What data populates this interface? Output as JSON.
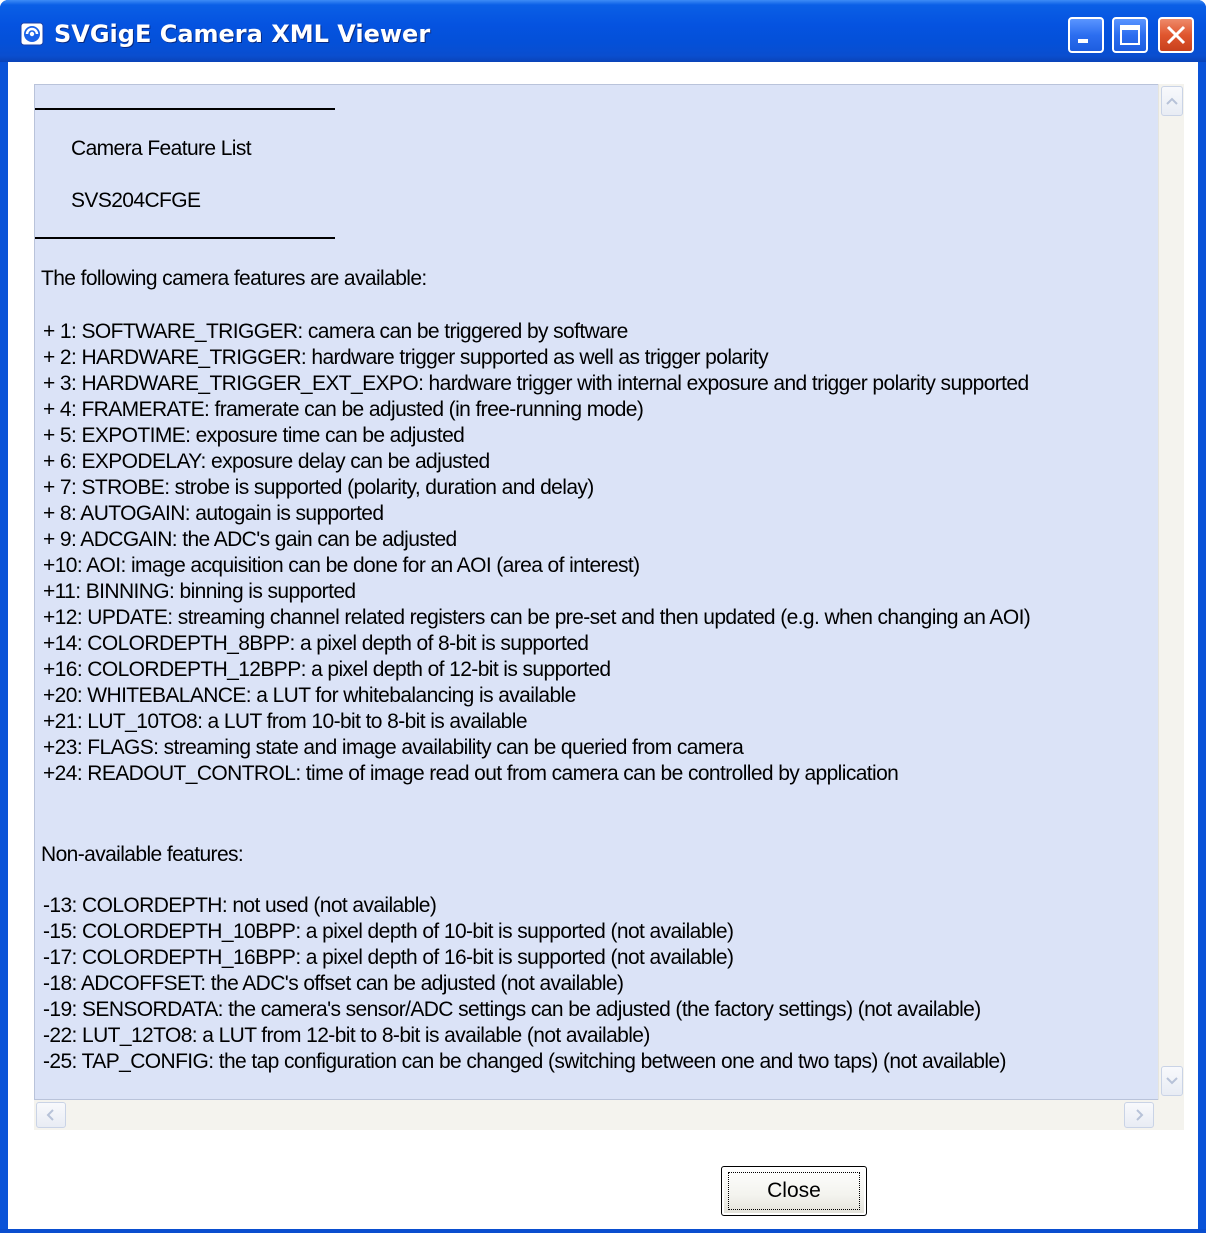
{
  "window": {
    "title": "SVGigE Camera XML Viewer",
    "icon": "svgige-app-icon",
    "controls": {
      "minimize_icon": "minimize-icon",
      "maximize_icon": "maximize-icon",
      "close_icon": "close-icon"
    },
    "colors": {
      "titlebar": "#0553e0",
      "content_background": "#dbe3f7",
      "close_button": "#e0562e"
    }
  },
  "document": {
    "heading": "Camera Feature List",
    "model": "SVS204CFGE",
    "available_intro": "The following camera features are available:",
    "available": [
      "+ 1: SOFTWARE_TRIGGER: camera can be triggered by software",
      "+ 2: HARDWARE_TRIGGER: hardware trigger supported as well as trigger polarity",
      "+ 3: HARDWARE_TRIGGER_EXT_EXPO: hardware trigger with internal exposure and trigger polarity supported",
      "+ 4: FRAMERATE: framerate can be adjusted (in free-running mode)",
      "+ 5: EXPOTIME: exposure time can be adjusted",
      "+ 6: EXPODELAY: exposure delay can be adjusted",
      "+ 7: STROBE: strobe is supported (polarity, duration and delay)",
      "+ 8: AUTOGAIN: autogain is supported",
      "+ 9: ADCGAIN: the ADC's gain can be adjusted",
      "+10: AOI: image acquisition can be done for an AOI (area of interest)",
      "+11: BINNING: binning is supported",
      "+12: UPDATE: streaming channel related registers can be pre-set and then updated (e.g. when changing an AOI)",
      "+14: COLORDEPTH_8BPP: a pixel depth of 8-bit is supported",
      "+16: COLORDEPTH_12BPP: a pixel depth of 12-bit is supported",
      "+20: WHITEBALANCE: a LUT for whitebalancing is available",
      "+21: LUT_10TO8: a LUT from 10-bit to 8-bit is available",
      "+23: FLAGS: streaming state and image availability can be queried from camera",
      "+24: READOUT_CONTROL: time of image read out from camera can be controlled by application"
    ],
    "unavailable_intro": "Non-available features:",
    "unavailable": [
      "-13: COLORDEPTH: not used (not available)",
      "-15: COLORDEPTH_10BPP: a pixel depth of 10-bit is supported (not available)",
      "-17: COLORDEPTH_16BPP: a pixel depth of 16-bit is supported (not available)",
      "-18: ADCOFFSET: the ADC's offset can be adjusted (not available)",
      "-19: SENSORDATA: the camera's sensor/ADC settings can be adjusted (the factory settings) (not available)",
      "-22: LUT_12TO8: a LUT from 12-bit to 8-bit is available (not available)",
      "-25: TAP_CONFIG: the tap configuration can be changed (switching between one and two taps) (not available)"
    ]
  },
  "scrollbars": {
    "up_icon": "scroll-up-arrow-icon",
    "down_icon": "scroll-down-arrow-icon",
    "left_icon": "scroll-left-arrow-icon",
    "right_icon": "scroll-right-arrow-icon"
  },
  "footer": {
    "close_label": "Close"
  }
}
